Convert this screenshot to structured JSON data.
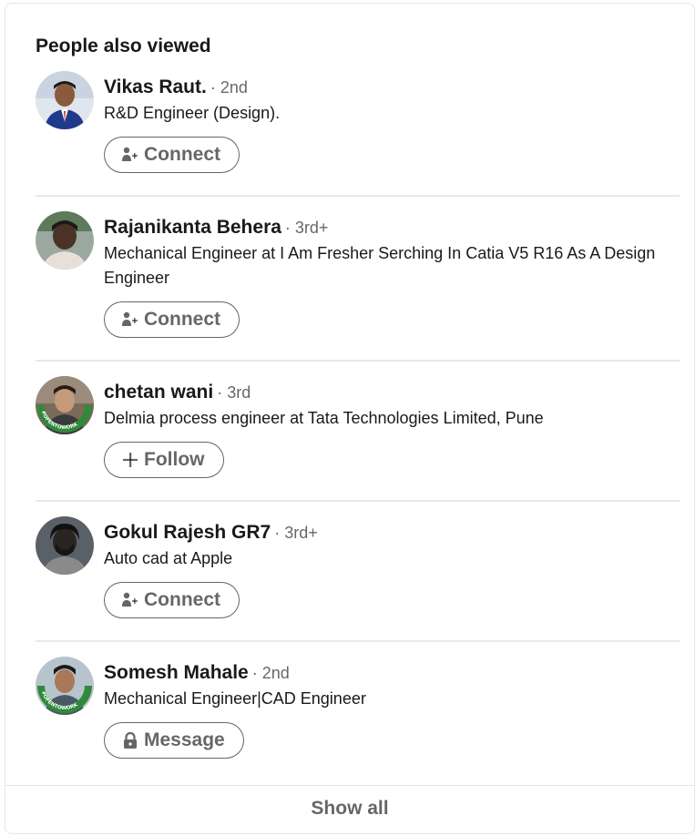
{
  "section": {
    "title": "People also viewed",
    "show_all_label": "Show all"
  },
  "people": [
    {
      "name": "Vikas Raut.",
      "degree": "· 2nd",
      "headline": "R&D Engineer (Design).",
      "action": {
        "label": "Connect",
        "icon": "add-person-icon"
      },
      "avatar_bg": "#3b6fc4"
    },
    {
      "name": "Rajanikanta Behera",
      "degree": "· 3rd+",
      "headline": "Mechanical Engineer at I Am Fresher Serching In Catia V5 R16 As A Design Engineer",
      "action": {
        "label": "Connect",
        "icon": "add-person-icon"
      },
      "avatar_bg": "#6a8f5a"
    },
    {
      "name": "chetan wani",
      "degree": "· 3rd",
      "headline": "Delmia process engineer at Tata Technologies Limited, Pune",
      "action": {
        "label": "Follow",
        "icon": "plus-icon"
      },
      "avatar_bg": "#5a4a3a",
      "open_to_work": "#OPENTOWORK"
    },
    {
      "name": "Gokul Rajesh GR7",
      "degree": "· 3rd+",
      "headline": "Auto cad at Apple",
      "action": {
        "label": "Connect",
        "icon": "add-person-icon"
      },
      "avatar_bg": "#3a3a3a"
    },
    {
      "name": "Somesh Mahale",
      "degree": "· 2nd",
      "headline": "Mechanical Engineer|CAD Engineer",
      "action": {
        "label": "Message",
        "icon": "lock-icon"
      },
      "avatar_bg": "#7a8a9a",
      "open_to_work": "#OPENTOWORK"
    }
  ],
  "colors": {
    "open_to_work_green": "#2f8a3a",
    "secondary_text": "#666666"
  }
}
